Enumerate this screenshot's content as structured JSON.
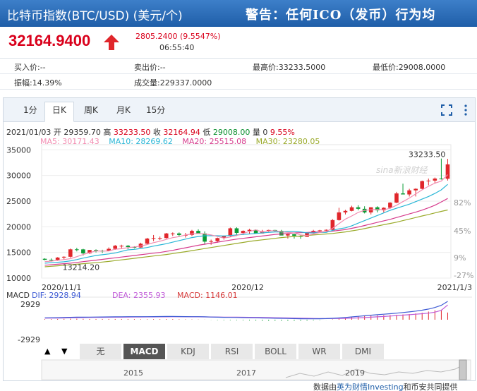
{
  "title_bar": {
    "name": "比特币指数(BTC/USD) (美元/个)",
    "warning": "警告：任何ICO（发币）行为均"
  },
  "quote": {
    "price": "32164.9400",
    "change": "2805.2400 (9.5547%)",
    "time": "06:55:40"
  },
  "stats": {
    "buy": "买入价:--",
    "sell": "卖出价:--",
    "high": "最高价:33233.5000",
    "low": "最低价:29008.0000",
    "amplitude": "振幅:14.39%",
    "volume": "成交量:229337.0000"
  },
  "period_tabs": [
    "1分",
    "日K",
    "周K",
    "月K",
    "15分"
  ],
  "active_period": "日K",
  "ohlc": {
    "date": "2021/01/03",
    "open_label": "开",
    "open": "29359.70",
    "high_label": "高",
    "high": "33233.50",
    "close_label": "收",
    "close": "32164.94",
    "low_label": "低",
    "low": "29008.00",
    "vol_label": "量",
    "vol": "0",
    "pct": "9.55%"
  },
  "ma_legend": {
    "ma5": "MA5: 30171.43",
    "ma10": "MA10: 28269.62",
    "ma20": "MA20: 25515.08",
    "ma30": "MA30: 23280.05"
  },
  "macd_legend": {
    "name": "MACD",
    "dif": "DIF: 2928.94",
    "dea": "DEA: 2355.93",
    "macd": "MACD: 1146.01"
  },
  "indicator_tabs": [
    "无",
    "MACD",
    "KDJ",
    "RSI",
    "BOLL",
    "WR",
    "DMI"
  ],
  "active_indicator": "MACD",
  "nav": {
    "prev": "▲",
    "next": "▼"
  },
  "navigator_years": [
    "2015",
    "2017",
    "2019"
  ],
  "watermark": "sina新浪财经",
  "credit": {
    "prefix": "数据由",
    "provider": "英为财情Investing",
    "suffix": "和币安共同提供"
  },
  "colors": {
    "up": "#e0262b",
    "down": "#0a9b34",
    "ma5": "#f28bb0",
    "ma10": "#29b6d6",
    "ma20": "#d63a8c",
    "ma30": "#9aaa2a",
    "dif": "#3e5bd4",
    "dea": "#c05ad8"
  },
  "chart_data": {
    "type": "candlestick",
    "x_start": "2020/11/1",
    "x_mid": "2020/12",
    "x_end": "2021/1/3",
    "ylim": [
      10000,
      36000
    ],
    "yticks": [
      10000,
      15000,
      20000,
      25000,
      30000,
      35000
    ],
    "pct_ticks": [
      "82%",
      "45%",
      "9%",
      "-27%"
    ],
    "max_label": "33233.50",
    "min_label": "13214.20",
    "dates": [
      "2020/11/1",
      "2020/11/2",
      "2020/11/3",
      "2020/11/4",
      "2020/11/5",
      "2020/11/6",
      "2020/11/7",
      "2020/11/8",
      "2020/11/9",
      "2020/11/10",
      "2020/11/11",
      "2020/11/12",
      "2020/11/13",
      "2020/11/14",
      "2020/11/15",
      "2020/11/16",
      "2020/11/17",
      "2020/11/18",
      "2020/11/19",
      "2020/11/20",
      "2020/11/21",
      "2020/11/22",
      "2020/11/23",
      "2020/11/24",
      "2020/11/25",
      "2020/11/26",
      "2020/11/27",
      "2020/11/28",
      "2020/11/29",
      "2020/11/30",
      "2020/12/1",
      "2020/12/2",
      "2020/12/3",
      "2020/12/4",
      "2020/12/5",
      "2020/12/6",
      "2020/12/7",
      "2020/12/8",
      "2020/12/9",
      "2020/12/10",
      "2020/12/11",
      "2020/12/12",
      "2020/12/13",
      "2020/12/14",
      "2020/12/15",
      "2020/12/16",
      "2020/12/17",
      "2020/12/18",
      "2020/12/19",
      "2020/12/20",
      "2020/12/21",
      "2020/12/22",
      "2020/12/23",
      "2020/12/24",
      "2020/12/25",
      "2020/12/26",
      "2020/12/27",
      "2020/12/28",
      "2020/12/29",
      "2020/12/30",
      "2020/12/31",
      "2021/1/1",
      "2021/1/2",
      "2021/1/3"
    ],
    "open": [
      13760,
      13560,
      13550,
      14000,
      14150,
      15600,
      15590,
      14820,
      15480,
      15330,
      15300,
      15700,
      16300,
      16300,
      16050,
      15960,
      16700,
      17700,
      17800,
      17800,
      18700,
      18700,
      18400,
      18400,
      19200,
      18700,
      17100,
      17200,
      17800,
      18200,
      19700,
      18800,
      19200,
      19400,
      18700,
      19150,
      19370,
      19200,
      18300,
      18550,
      18250,
      18050,
      18800,
      19200,
      19300,
      19400,
      21300,
      22800,
      23100,
      23800,
      23500,
      22800,
      23800,
      23200,
      23700,
      24700,
      26500,
      26300,
      27100,
      27400,
      28900,
      29000,
      29400,
      29360
    ],
    "high": [
      13860,
      13820,
      14080,
      14250,
      15750,
      15900,
      15700,
      15500,
      15600,
      15520,
      15980,
      16450,
      16500,
      16450,
      16200,
      16890,
      17850,
      18400,
      18100,
      18800,
      18900,
      18900,
      18800,
      19400,
      19500,
      19100,
      17500,
      17900,
      18300,
      19850,
      19900,
      19300,
      19600,
      19500,
      19400,
      19420,
      19400,
      19400,
      18700,
      18600,
      18450,
      18900,
      19400,
      19400,
      19500,
      21500,
      23700,
      23300,
      24100,
      24200,
      24000,
      23800,
      24000,
      23800,
      24800,
      26800,
      28400,
      27400,
      27500,
      29000,
      29400,
      29600,
      33300,
      33233
    ],
    "low": [
      13480,
      13220,
      13340,
      13640,
      14000,
      15200,
      14400,
      14700,
      15000,
      14900,
      15250,
      15500,
      15800,
      15650,
      15800,
      15900,
      16600,
      17200,
      17400,
      17700,
      18200,
      18100,
      17900,
      18200,
      18900,
      16500,
      16500,
      16900,
      17500,
      18000,
      18200,
      18400,
      18600,
      18700,
      18700,
      19000,
      19000,
      18500,
      17700,
      17700,
      17650,
      18000,
      18700,
      19000,
      19100,
      19300,
      21200,
      22400,
      23000,
      23200,
      22600,
      22400,
      22800,
      22800,
      23500,
      24600,
      26300,
      25900,
      25900,
      27300,
      28100,
      28400,
      29200,
      29008
    ],
    "close": [
      13560,
      13550,
      14000,
      14150,
      15600,
      15590,
      14820,
      15480,
      15330,
      15300,
      15700,
      16300,
      16300,
      16050,
      15960,
      16700,
      17700,
      17800,
      17800,
      18700,
      18700,
      18400,
      18400,
      19200,
      18700,
      17100,
      17200,
      17800,
      18200,
      19700,
      18800,
      19200,
      19400,
      18700,
      19150,
      19370,
      19200,
      18300,
      18550,
      18250,
      18050,
      18800,
      19200,
      19300,
      19400,
      21300,
      22800,
      23100,
      23800,
      23500,
      22800,
      23800,
      23200,
      23700,
      24700,
      26500,
      26300,
      27100,
      27400,
      28900,
      29000,
      29400,
      29360,
      32165
    ],
    "ma5": [
      13200,
      13300,
      13450,
      13600,
      13780,
      14170,
      14600,
      14950,
      15290,
      15250,
      15280,
      15620,
      15720,
      15930,
      16060,
      16240,
      16540,
      16900,
      17180,
      17540,
      17880,
      18080,
      18400,
      18600,
      18700,
      18600,
      18400,
      18100,
      17800,
      18000,
      18300,
      18700,
      19100,
      19400,
      19000,
      19200,
      19250,
      19000,
      18900,
      18800,
      18400,
      18300,
      18600,
      18900,
      19100,
      19700,
      20600,
      21500,
      22100,
      22800,
      23200,
      23300,
      23400,
      23300,
      23600,
      24200,
      24900,
      25600,
      26400,
      27200,
      27900,
      28500,
      28900,
      30171
    ],
    "ma10": [
      12900,
      13000,
      13080,
      13180,
      13350,
      13600,
      13900,
      14150,
      14400,
      14550,
      14700,
      14900,
      15200,
      15500,
      15600,
      15760,
      15960,
      16230,
      16470,
      16700,
      17000,
      17300,
      17600,
      17900,
      18100,
      18250,
      18250,
      18250,
      18200,
      18300,
      18400,
      18500,
      18600,
      18700,
      18800,
      18900,
      19000,
      19000,
      19100,
      19100,
      19000,
      18800,
      18800,
      18900,
      18900,
      19300,
      19600,
      19800,
      20200,
      20700,
      21200,
      21700,
      22200,
      22700,
      23200,
      23600,
      24000,
      24400,
      24900,
      25400,
      25900,
      26500,
      27200,
      28270
    ],
    "ma20": [
      12500,
      12600,
      12700,
      12800,
      12900,
      13050,
      13200,
      13350,
      13500,
      13650,
      13800,
      13950,
      14100,
      14250,
      14400,
      14550,
      14700,
      14850,
      15000,
      15200,
      15400,
      15650,
      15900,
      16150,
      16400,
      16600,
      16800,
      17000,
      17200,
      17400,
      17600,
      17750,
      17900,
      18050,
      18200,
      18350,
      18500,
      18600,
      18700,
      18800,
      18850,
      18900,
      18950,
      19000,
      19050,
      19150,
      19300,
      19450,
      19700,
      19950,
      20250,
      20550,
      20850,
      21150,
      21450,
      21800,
      22150,
      22500,
      22850,
      23250,
      23700,
      24200,
      24850,
      25515
    ],
    "ma30": [
      12200,
      12300,
      12400,
      12500,
      12600,
      12700,
      12800,
      12900,
      13000,
      13120,
      13250,
      13400,
      13550,
      13700,
      13850,
      14000,
      14150,
      14300,
      14450,
      14600,
      14780,
      14960,
      15150,
      15350,
      15550,
      15750,
      15950,
      16150,
      16350,
      16550,
      16750,
      16950,
      17150,
      17300,
      17450,
      17600,
      17750,
      17900,
      18000,
      18100,
      18200,
      18300,
      18400,
      18500,
      18600,
      18700,
      18850,
      19000,
      19200,
      19400,
      19650,
      19900,
      20150,
      20400,
      20650,
      20900,
      21200,
      21500,
      21800,
      22100,
      22400,
      22700,
      23000,
      23280
    ],
    "macd_ylim": [
      -2929,
      2929
    ],
    "macd_ticks": [
      "2929",
      "-2929"
    ],
    "dif": [
      300,
      310,
      330,
      350,
      380,
      400,
      410,
      420,
      430,
      440,
      450,
      460,
      470,
      480,
      480,
      480,
      490,
      500,
      510,
      520,
      520,
      510,
      500,
      490,
      480,
      460,
      430,
      400,
      380,
      370,
      360,
      340,
      320,
      300,
      280,
      260,
      240,
      220,
      200,
      180,
      160,
      150,
      150,
      160,
      180,
      220,
      280,
      360,
      450,
      540,
      630,
      720,
      800,
      880,
      960,
      1050,
      1150,
      1250,
      1380,
      1520,
      1700,
      1950,
      2300,
      2929
    ],
    "dea": [
      250,
      260,
      270,
      280,
      300,
      320,
      340,
      360,
      370,
      380,
      390,
      400,
      410,
      420,
      430,
      440,
      450,
      455,
      460,
      465,
      470,
      470,
      470,
      465,
      460,
      450,
      440,
      430,
      420,
      410,
      400,
      390,
      380,
      370,
      360,
      340,
      320,
      300,
      280,
      260,
      240,
      220,
      200,
      190,
      185,
      190,
      200,
      220,
      250,
      290,
      340,
      400,
      460,
      520,
      590,
      660,
      730,
      800,
      880,
      960,
      1050,
      1200,
      1500,
      2356
    ],
    "hist": [
      100,
      100,
      120,
      140,
      160,
      160,
      140,
      120,
      120,
      120,
      120,
      120,
      120,
      120,
      100,
      80,
      80,
      90,
      100,
      110,
      100,
      80,
      60,
      50,
      40,
      20,
      -20,
      -60,
      -80,
      -80,
      -80,
      -100,
      -120,
      -140,
      -160,
      -160,
      -160,
      -160,
      -160,
      -160,
      -160,
      -140,
      -100,
      -60,
      -10,
      60,
      160,
      280,
      400,
      500,
      580,
      640,
      680,
      720,
      740,
      780,
      840,
      900,
      1000,
      1120,
      1300,
      1500,
      1600,
      1146
    ]
  }
}
